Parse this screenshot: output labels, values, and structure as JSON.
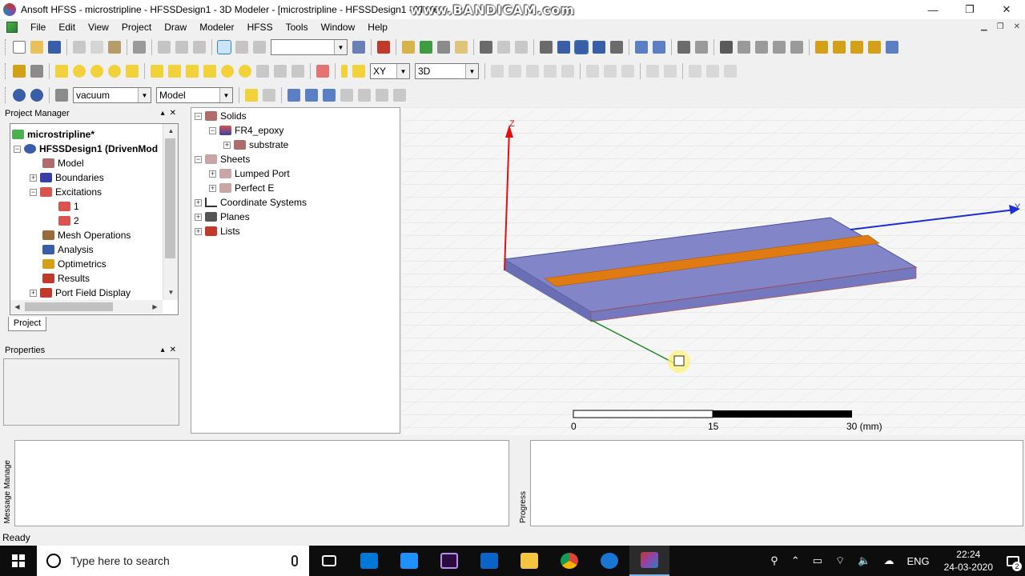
{
  "window": {
    "title": "Ansoft HFSS  - microstripline - HFSSDesign1 - 3D Modeler - [microstripline - HFSSDesign1 - Mode",
    "watermark": "www.BANDICAM.com",
    "minimize": "—",
    "restore": "❐",
    "close": "✕"
  },
  "menu": {
    "items": [
      "File",
      "Edit",
      "View",
      "Project",
      "Draw",
      "Modeler",
      "HFSS",
      "Tools",
      "Window",
      "Help"
    ]
  },
  "toolbar": {
    "material_value": "vacuum",
    "model_value": "Model",
    "plane_value": "XY",
    "view_value": "3D"
  },
  "project_manager": {
    "title": "Project Manager",
    "tree": [
      {
        "label": "microstripline*",
        "icon": "project-icon",
        "bold": true
      },
      {
        "label": "HFSSDesign1 (DrivenMod",
        "icon": "design-icon",
        "bold": true
      },
      {
        "label": "Model",
        "icon": "model-icon"
      },
      {
        "label": "Boundaries",
        "icon": "boundaries-icon"
      },
      {
        "label": "Excitations",
        "icon": "excitations-icon"
      },
      {
        "label": "1",
        "icon": "port-icon"
      },
      {
        "label": "2",
        "icon": "port-icon"
      },
      {
        "label": "Mesh Operations",
        "icon": "mesh-icon"
      },
      {
        "label": "Analysis",
        "icon": "analysis-icon"
      },
      {
        "label": "Optimetrics",
        "icon": "optimetrics-icon"
      },
      {
        "label": "Results",
        "icon": "results-icon"
      },
      {
        "label": "Port Field Display",
        "icon": "field-display-icon"
      }
    ],
    "tab": "Project"
  },
  "properties": {
    "title": "Properties"
  },
  "model_tree": {
    "items": [
      {
        "label": "Solids"
      },
      {
        "label": "FR4_epoxy"
      },
      {
        "label": "substrate"
      },
      {
        "label": "Sheets"
      },
      {
        "label": "Lumped Port"
      },
      {
        "label": "Perfect E"
      },
      {
        "label": "Coordinate Systems"
      },
      {
        "label": "Planes"
      },
      {
        "label": "Lists"
      }
    ]
  },
  "viewport": {
    "axis_z": "Z",
    "axis_y": "Y",
    "scale": {
      "start": "0",
      "mid": "15",
      "end": "30 (mm)"
    },
    "colors": {
      "substrate": "#7b7fc4",
      "strip": "#e07b14",
      "axis_x": "#1a8a1a",
      "axis_y": "#1a2fd6",
      "axis_z": "#e01010"
    }
  },
  "bottom": {
    "message_label": "Message Manage",
    "progress_label": "Progress"
  },
  "status": {
    "text": "Ready"
  },
  "taskbar": {
    "search_placeholder": "Type here to search",
    "language": "ENG",
    "time": "22:24",
    "date": "24-03-2020",
    "notifications": "2"
  }
}
